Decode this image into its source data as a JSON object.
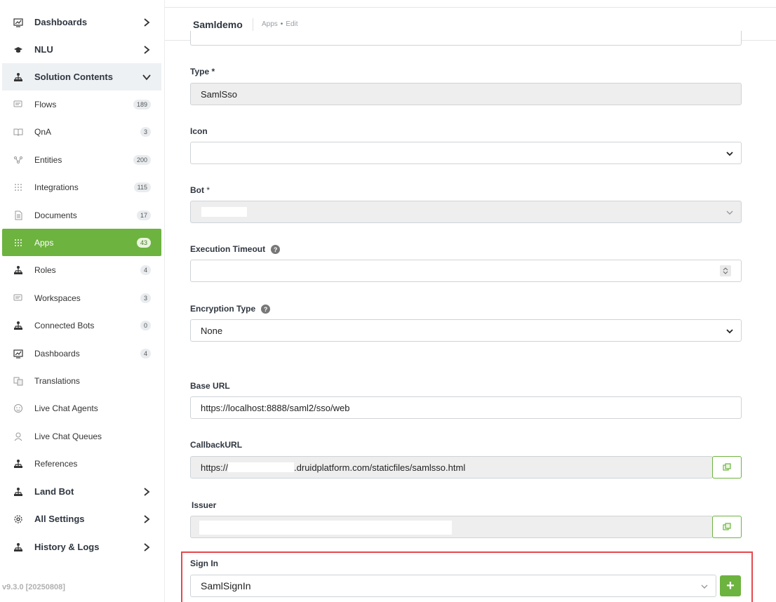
{
  "sidebar": {
    "items": [
      {
        "label": "Dashboards",
        "icon": "chart-icon",
        "kind": "top",
        "chevron": "right"
      },
      {
        "label": "NLU",
        "icon": "graduation-cap-icon",
        "kind": "top",
        "chevron": "right"
      },
      {
        "label": "Solution Contents",
        "icon": "hierarchy-icon",
        "kind": "top",
        "chevron": "down"
      },
      {
        "label": "Flows",
        "icon": "chat-icon",
        "badge": "189"
      },
      {
        "label": "QnA",
        "icon": "book-icon",
        "badge": "3"
      },
      {
        "label": "Entities",
        "icon": "entities-icon",
        "badge": "200"
      },
      {
        "label": "Integrations",
        "icon": "grid-dots-icon",
        "badge": "115"
      },
      {
        "label": "Documents",
        "icon": "document-icon",
        "badge": "17"
      },
      {
        "label": "Apps",
        "icon": "apps-grid-icon",
        "badge": "43",
        "active": true
      },
      {
        "label": "Roles",
        "icon": "hierarchy-icon",
        "badge": "4"
      },
      {
        "label": "Workspaces",
        "icon": "chat-icon",
        "badge": "3"
      },
      {
        "label": "Connected Bots",
        "icon": "hierarchy-icon",
        "badge": "0"
      },
      {
        "label": "Dashboards",
        "icon": "chart-icon",
        "badge": "4"
      },
      {
        "label": "Translations",
        "icon": "translate-icon"
      },
      {
        "label": "Live Chat Agents",
        "icon": "agent-icon"
      },
      {
        "label": "Live Chat Queues",
        "icon": "queue-icon"
      },
      {
        "label": "References",
        "icon": "hierarchy-icon"
      },
      {
        "label": "Land Bot",
        "icon": "hierarchy-icon",
        "kind": "top",
        "chevron": "right"
      },
      {
        "label": "All Settings",
        "icon": "gear-icon",
        "kind": "top",
        "chevron": "right"
      },
      {
        "label": "History & Logs",
        "icon": "hierarchy-icon",
        "kind": "top",
        "chevron": "right"
      }
    ],
    "version": "v9.3.0 [20250808]"
  },
  "header": {
    "title": "Samldemo",
    "breadcrumb": [
      "Apps",
      "Edit"
    ]
  },
  "form": {
    "type_label": "Type",
    "type_required": "*",
    "type_value": "SamlSso",
    "icon_label": "Icon",
    "icon_value": "",
    "bot_label": "Bot",
    "bot_required": "*",
    "timeout_label": "Execution Timeout",
    "timeout_value": "",
    "encryption_label": "Encryption Type",
    "encryption_value": "None",
    "base_url_label": "Base URL",
    "base_url_value": "https://localhost:8888/saml2/sso/web",
    "callback_label": "CallbackURL",
    "callback_prefix": "https://",
    "callback_suffix": ".druidplatform.com/staticfiles/samlsso.html",
    "issuer_label": "Issuer",
    "sign_in_label": "Sign In",
    "sign_in_value": "SamlSignIn",
    "add_label": "+"
  },
  "colors": {
    "accent": "#6db33f",
    "highlight": "#e5484d"
  }
}
